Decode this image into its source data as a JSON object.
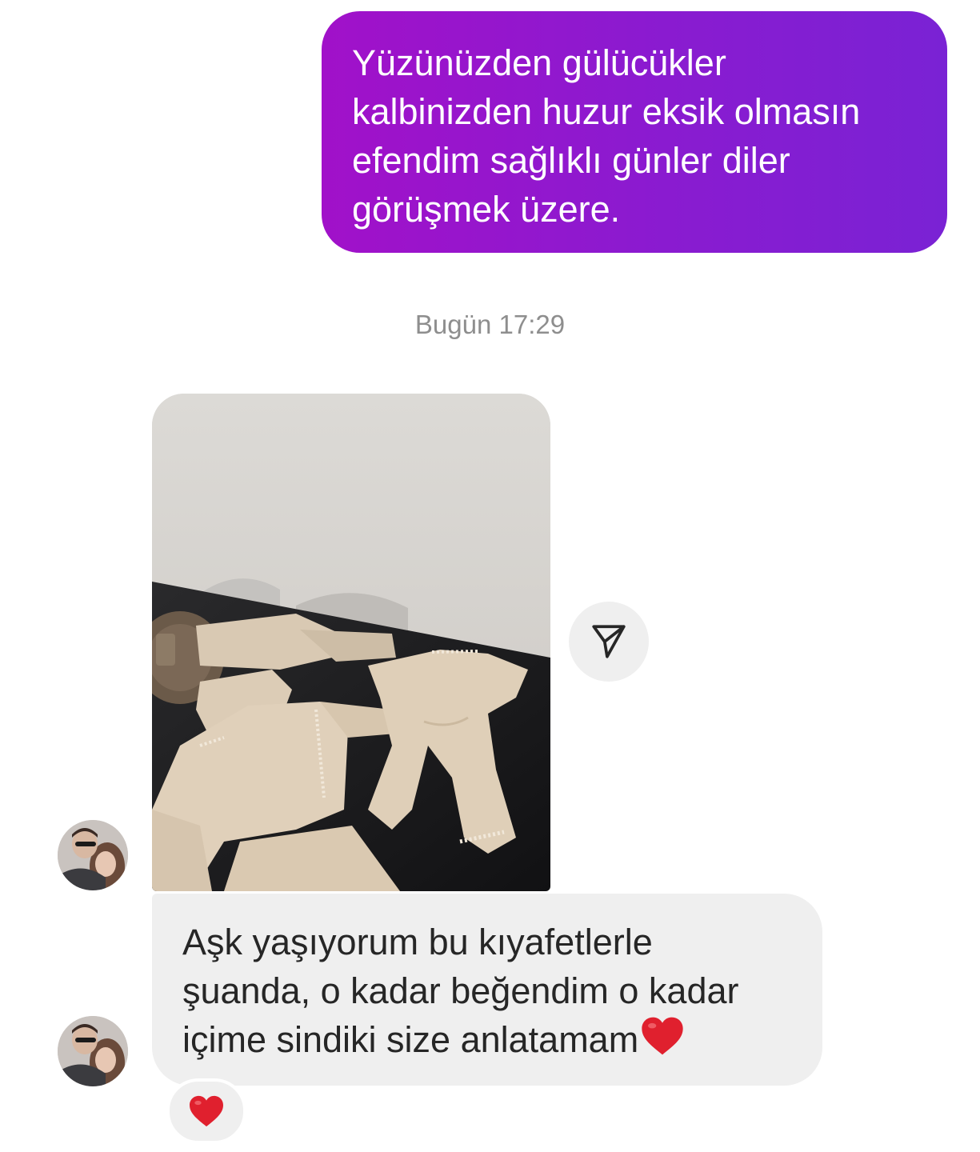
{
  "thread": {
    "sent_message": {
      "text": "Yüzünüzden gülücükler\nkalbinizden huzur eksik olmasın\nefendim sağlıklı günler diler\ngörüşmek üzere.",
      "bubble_gradient": [
        "#a111c9",
        "#7a22d4"
      ]
    },
    "timestamp": "Bugün 17:29",
    "received": {
      "photo_icon": "clothing-photo",
      "share_icon": "paper-plane-icon",
      "text": "Aşk yaşıyorum bu kıyafetlerle\nşuanda, o kadar beğendim o kadar\niçime sindiki size anlatamam",
      "inline_emoji": "heart-emoji-icon",
      "reaction": "heart-reaction-icon",
      "reaction_color": "#e0202e"
    }
  }
}
